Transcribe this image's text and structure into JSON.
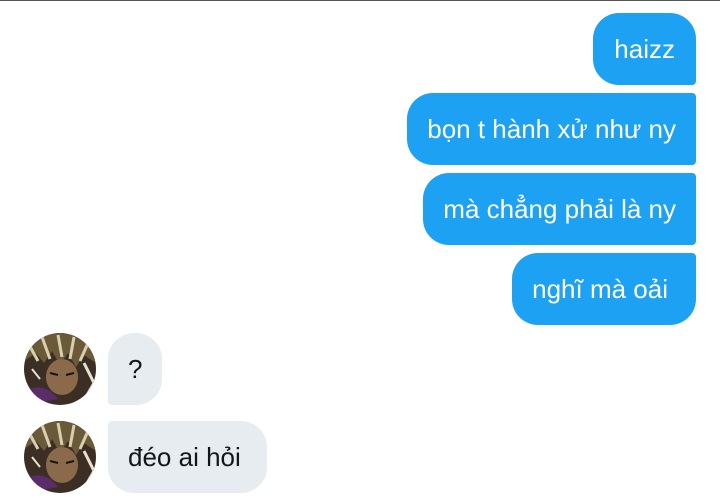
{
  "conversation": {
    "messages": [
      {
        "sender": "me",
        "text": "haizz"
      },
      {
        "sender": "me",
        "text": "bọn t hành xử như ny"
      },
      {
        "sender": "me",
        "text": "mà chẳng phải là ny"
      },
      {
        "sender": "me",
        "text": "nghĩ mà oải"
      },
      {
        "sender": "other",
        "text": "?"
      },
      {
        "sender": "other",
        "text": "đéo ai hỏi"
      }
    ]
  },
  "colors": {
    "outgoing_bubble": "#1da1f2",
    "incoming_bubble": "#e6ecf0",
    "outgoing_text": "#ffffff",
    "incoming_text": "#14171a"
  },
  "icons": {
    "avatar": "anime-character-avatar"
  }
}
